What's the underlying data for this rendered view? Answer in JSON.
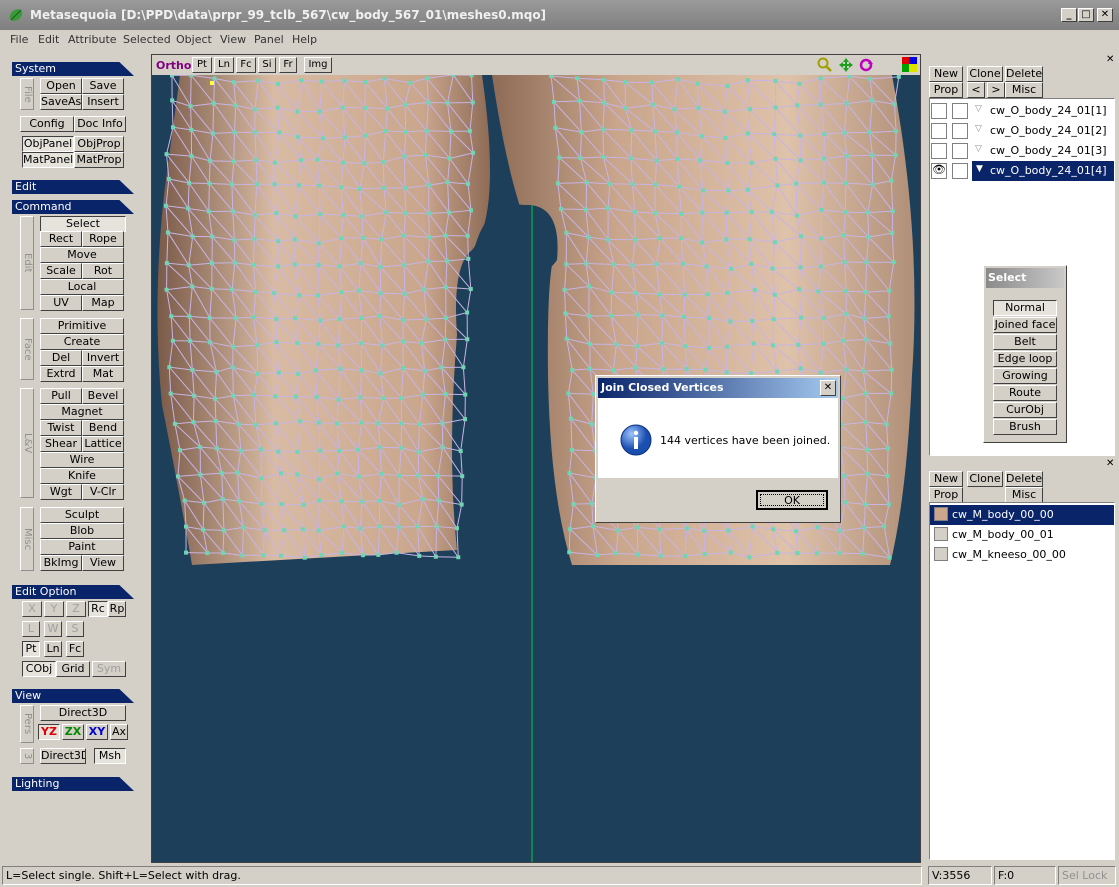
{
  "window": {
    "title": "Metasequoia [D:\\PPD\\data\\prpr_99_tclb_567\\cw_body_567_01\\meshes0.mqo]"
  },
  "menu": [
    "File",
    "Edit",
    "Attribute",
    "Selected",
    "Object",
    "View",
    "Panel",
    "Help"
  ],
  "sidebar": {
    "system_header": "System",
    "file_label": "File",
    "open": "Open",
    "save": "Save",
    "saveas": "SaveAs",
    "insert": "Insert",
    "config": "Config",
    "docinfo": "Doc Info",
    "objpanel": "ObjPanel",
    "objprop": "ObjProp",
    "matpanel": "MatPanel",
    "matprop": "MatProp",
    "edit_header": "Edit",
    "command_header": "Command",
    "edit_label": "Edit",
    "select": "Select",
    "rect": "Rect",
    "rope": "Rope",
    "move": "Move",
    "scale": "Scale",
    "rot": "Rot",
    "local": "Local",
    "uv": "UV",
    "map": "Map",
    "face_label": "Face",
    "primitive": "Primitive",
    "create": "Create",
    "del": "Del",
    "invert": "Invert",
    "extrd": "Extrd",
    "mat": "Mat",
    "lv_label": "L&V",
    "pull": "Pull",
    "bevel": "Bevel",
    "magnet": "Magnet",
    "twist": "Twist",
    "bend": "Bend",
    "shear": "Shear",
    "lattice": "Lattice",
    "wire": "Wire",
    "knife": "Knife",
    "wgt": "Wgt",
    "vclr": "V-Clr",
    "misc_label": "Misc",
    "sculpt": "Sculpt",
    "blob": "Blob",
    "paint": "Paint",
    "bkimg": "BkImg",
    "view": "View",
    "editopt_header": "Edit Option",
    "x": "X",
    "y": "Y",
    "z": "Z",
    "rc": "Rc",
    "rp": "Rp",
    "l": "L",
    "w": "W",
    "s": "S",
    "pt": "Pt",
    "ln": "Ln",
    "fc": "Fc",
    "cobj": "CObj",
    "grid": "Grid",
    "sym": "Sym",
    "view_header": "View",
    "pers_label": "Pers",
    "direct3d_1": "Direct3D",
    "yz": "YZ",
    "zx": "ZX",
    "xy": "XY",
    "ax": "Ax",
    "three_label": "3",
    "direct3d_2": "Direct3D",
    "msh": "Msh",
    "lighting_header": "Lighting"
  },
  "viewport": {
    "ortho": "Ortho",
    "pt": "Pt",
    "ln": "Ln",
    "fc": "Fc",
    "si": "Si",
    "fr": "Fr",
    "img": "Img",
    "colors": {
      "bg": "#1e3f5a",
      "skin": "#c9a88e",
      "wire": "#c8b4e6",
      "vertex": "#6fd6b4",
      "axis": "#00cc44"
    }
  },
  "object_panel": {
    "new": "New",
    "clone": "Clone",
    "delete": "Delete",
    "prop": "Prop",
    "prev": "<",
    "next": ">",
    "misc": "Misc",
    "objects": [
      {
        "name": "cw_O_body_24_01[1]",
        "visible": false,
        "selected": false
      },
      {
        "name": "cw_O_body_24_01[2]",
        "visible": false,
        "selected": false
      },
      {
        "name": "cw_O_body_24_01[3]",
        "visible": false,
        "selected": false
      },
      {
        "name": "cw_O_body_24_01[4]",
        "visible": true,
        "selected": true
      }
    ]
  },
  "select_palette": {
    "title": "Select",
    "items": [
      "Normal",
      "Joined face",
      "Belt",
      "Edge loop",
      "Growing",
      "Route",
      "CurObj",
      "Brush"
    ]
  },
  "material_panel": {
    "new": "New",
    "clone": "Clone",
    "delete": "Delete",
    "prop": "Prop",
    "misc": "Misc",
    "materials": [
      {
        "name": "cw_M_body_00_00",
        "selected": true
      },
      {
        "name": "cw_M_body_00_01",
        "selected": false
      },
      {
        "name": "cw_M_kneeso_00_00",
        "selected": false
      }
    ]
  },
  "dialog": {
    "title": "Join Closed Vertices",
    "message": "144 vertices have been joined.",
    "ok": "OK"
  },
  "status": {
    "hint": "L=Select single.  Shift+L=Select with drag.",
    "vertices": "V:3556",
    "faces": "F:0",
    "sel_lock": "Sel Lock"
  }
}
